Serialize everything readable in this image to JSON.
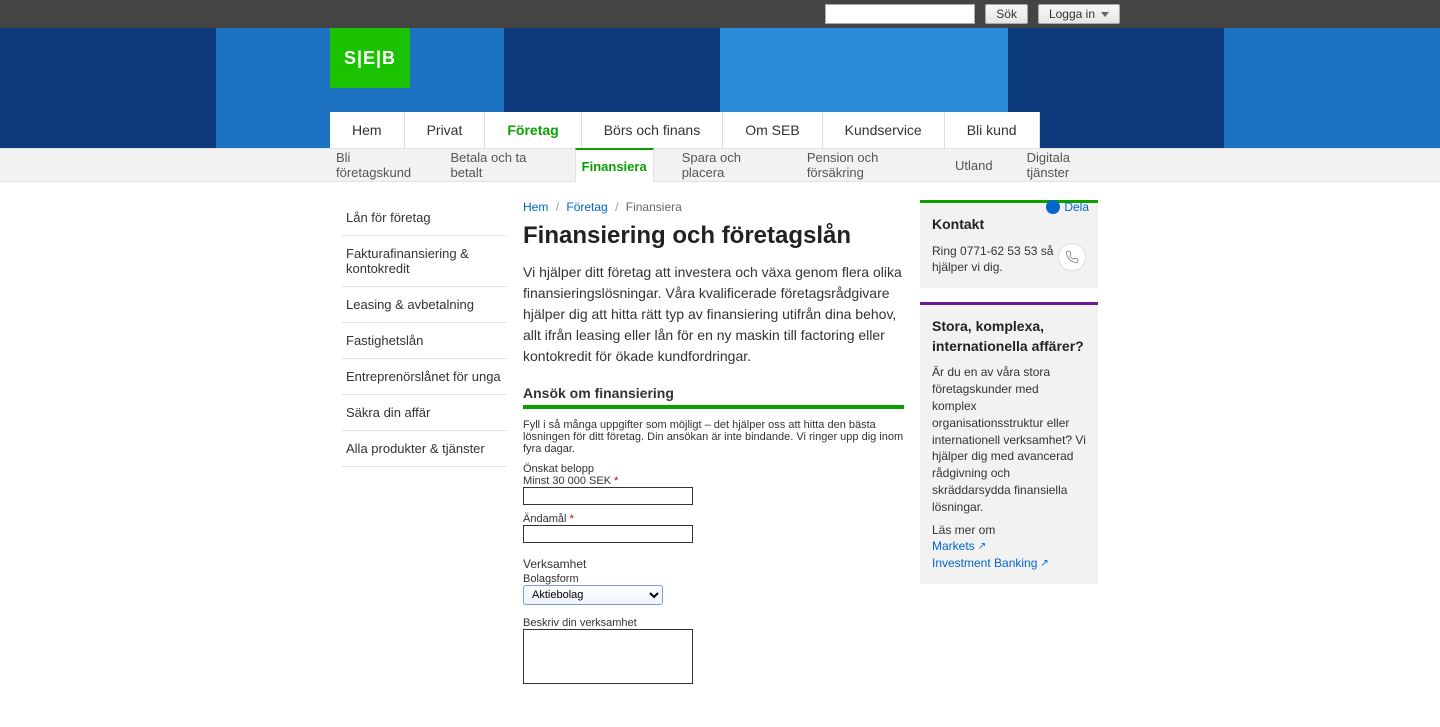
{
  "topbar": {
    "search_button": "Sök",
    "login_label": "Logga in"
  },
  "logo_text": "S|E|B",
  "primary_nav": [
    {
      "label": "Hem",
      "active": false
    },
    {
      "label": "Privat",
      "active": false
    },
    {
      "label": "Företag",
      "active": true
    },
    {
      "label": "Börs och finans",
      "active": false
    },
    {
      "label": "Om SEB",
      "active": false
    },
    {
      "label": "Kundservice",
      "active": false
    },
    {
      "label": "Bli kund",
      "active": false
    }
  ],
  "sub_nav": [
    {
      "label": "Bli företagskund",
      "active": false
    },
    {
      "label": "Betala och ta betalt",
      "active": false
    },
    {
      "label": "Finansiera",
      "active": true
    },
    {
      "label": "Spara och placera",
      "active": false
    },
    {
      "label": "Pension och försäkring",
      "active": false
    },
    {
      "label": "Utland",
      "active": false
    },
    {
      "label": "Digitala tjänster",
      "active": false
    }
  ],
  "breadcrumb": {
    "items": [
      "Hem",
      "Företag"
    ],
    "current": "Finansiera"
  },
  "share_label": "Dela",
  "side_menu": [
    "Lån för företag",
    "Fakturafinansiering & kontokredit",
    "Leasing & avbetalning",
    "Fastighetslån",
    "Entreprenörslånet för unga",
    "Säkra din affär",
    "Alla produkter & tjänster"
  ],
  "page": {
    "title": "Finansiering och företagslån",
    "intro": "Vi hjälper ditt företag att investera och växa genom flera olika finansieringslösningar. Våra kvalificerade företagsrådgivare hjälper dig att hitta rätt typ av finansiering utifrån dina behov, allt ifrån leasing eller lån för en ny maskin till factoring eller kontokredit för ökade kundfordringar."
  },
  "apply": {
    "heading": "Ansök om finansiering",
    "note": "Fyll i så många uppgifter som möjligt – det hjälper oss att hitta den bästa lösningen för ditt företag. Din ansökan är inte bindande. Vi ringer upp dig inom fyra dagar.",
    "amount_label": "Önskat belopp",
    "amount_sub": "Minst 30 000 SEK",
    "purpose_label": "Ändamål",
    "business_heading": "Verksamhet",
    "company_form_label": "Bolagsform",
    "company_form_value": "Aktiebolag",
    "describe_label": "Beskriv din verksamhet"
  },
  "contact_box": {
    "title": "Kontakt",
    "text": "Ring 0771-62 53 53 så hjälper vi dig."
  },
  "complex_box": {
    "title": "Stora, komplexa, internationella affärer?",
    "text": "Är du en av våra stora företagskunder med komplex organisationsstruktur eller internationell verksamhet? Vi hjälper dig med avancerad rådgivning och skräddarsydda finansiella lösningar.",
    "read_more": "Läs mer om",
    "link1": "Markets",
    "link2": "Investment Banking"
  }
}
